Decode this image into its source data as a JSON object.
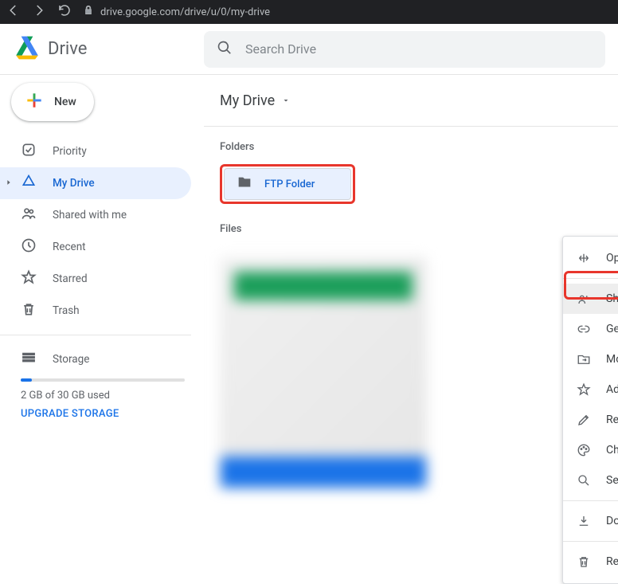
{
  "browser": {
    "url": "drive.google.com/drive/u/0/my-drive"
  },
  "app": {
    "name": "Drive",
    "search_placeholder": "Search Drive"
  },
  "new_button": {
    "label": "New"
  },
  "sidebar": {
    "items": [
      {
        "label": "Priority"
      },
      {
        "label": "My Drive"
      },
      {
        "label": "Shared with me"
      },
      {
        "label": "Recent"
      },
      {
        "label": "Starred"
      },
      {
        "label": "Trash"
      }
    ],
    "storage": {
      "label": "Storage",
      "usage_text": "2 GB of 30 GB used",
      "upgrade_label": "UPGRADE STORAGE"
    }
  },
  "content": {
    "path": "My Drive",
    "sections": {
      "folders_label": "Folders",
      "files_label": "Files"
    },
    "folder_name": "FTP Folder"
  },
  "context_menu": {
    "open_with": "Open with",
    "share": "Share",
    "get_link": "Get shareable link",
    "move_to": "Move to",
    "add_starred": "Add to Starred",
    "rename": "Rename",
    "change_color": "Change color",
    "search_within": "Search within FTP Folder",
    "download": "Download",
    "remove": "Remove"
  }
}
